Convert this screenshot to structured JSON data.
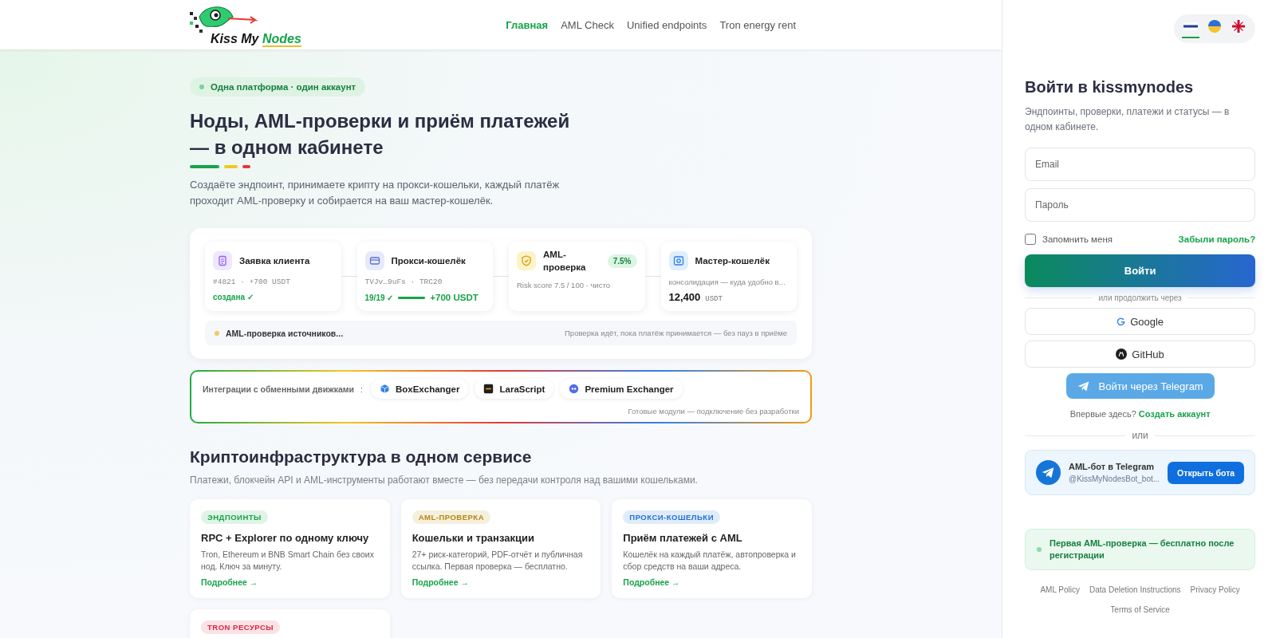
{
  "header": {
    "logo": {
      "text": "Kiss My",
      "accent": "Nodes"
    },
    "nav": [
      {
        "label": "Главная",
        "selected": true
      },
      {
        "label": "AML Check",
        "selected": false
      },
      {
        "label": "Unified endpoints",
        "selected": false
      },
      {
        "label": "Tron energy rent",
        "selected": false
      }
    ]
  },
  "hero": {
    "badge": "Одна платформа · один аккаунт",
    "title": "Ноды, AML-проверки и приём платежей — в одном кабинете",
    "lead": "Создаёте эндпоинт, принимаете крипту на прокси-кошельки, каждый платёж проходит AML-проверку и собирается на ваш мастер-кошелёк."
  },
  "pipeline": {
    "steps": [
      {
        "kind": "request",
        "title": "Заявка клиента",
        "meta": "#4821 · +700 USDT",
        "status": "создана ✓"
      },
      {
        "kind": "proxy",
        "title": "Прокси-кошелёк",
        "meta": "TVJv…9uFs · TRC20",
        "count": "19/19 ✓",
        "level": 1,
        "amount": "+700 USDT"
      },
      {
        "kind": "aml",
        "title": "AML-проверка",
        "badge": "7.5%",
        "note": "Risk score 7.5 / 100 · чисто"
      },
      {
        "kind": "master",
        "title": "Мастер-кошелёк",
        "meta": "консолидация — куда удобно в...",
        "amount": "12,400",
        "unit": "USDT"
      }
    ],
    "status": {
      "label": "AML-проверка источников...",
      "note": "Проверка идёт, пока платёж принимается — без пауз в приёме"
    }
  },
  "integrations": {
    "label": "Интеграции с обменными движками",
    "separator": ":",
    "engines": [
      {
        "kind": "cube",
        "name": "BoxExchanger"
      },
      {
        "kind": "square",
        "name": "LaraScript"
      },
      {
        "kind": "dots",
        "name": "Premium Exchanger"
      }
    ],
    "note": "Готовые модули — подключение без разработки"
  },
  "services": {
    "title": "Криптоинфраструктура в одном сервисе",
    "subtitle": "Платежи, блокчейн API и AML-инструменты работают вместе — без передачи контроля над вашими кошельками.",
    "cards": [
      {
        "tag": "ЭНДПОИНТЫ",
        "color": "#16a34a",
        "title": "RPC + Explorer по одному ключу",
        "text": "Tron, Ethereum и BNB Smart Chain без своих нод. Ключ за минуту.",
        "link": "Подробнее →"
      },
      {
        "tag": "AML-ПРОВЕРКА",
        "color": "#b7860b",
        "title": "Кошельки и транзакции",
        "text": "27+ риск-категорий, PDF-отчёт и публичная ссылка. Первая проверка — бесплатно.",
        "link": "Подробнее →"
      },
      {
        "tag": "ПРОКСИ-КОШЕЛЬКИ",
        "color": "#1d6fd8",
        "title": "Приём платежей с AML",
        "text": "Кошелёк на каждый платёж, автопроверка и сбор средств на ваши адреса.",
        "link": "Подробнее →"
      },
      {
        "tag": "TRON РЕСУРСЫ",
        "color": "#dc2640"
      }
    ]
  },
  "login": {
    "languages": [
      {
        "kind": "stripes",
        "selected": true
      },
      {
        "kind": "halves",
        "selected": false
      },
      {
        "kind": "cross",
        "selected": false
      }
    ],
    "title": "Войти в kissmynodes",
    "subtitle": "Эндпоинты, проверки, платежи и статусы — в одном кабинете.",
    "email": {
      "placeholder": "Email"
    },
    "password": {
      "placeholder": "Пароль"
    },
    "remember": {
      "label": "Запомнить меня",
      "checked": false
    },
    "forgot": "Забыли пароль?",
    "submit": "Войти",
    "divider": "или продолжить через",
    "providers": [
      {
        "kind": "google",
        "label": "Google"
      },
      {
        "kind": "github",
        "label": "GitHub"
      }
    ],
    "telegram": "Войти через Telegram",
    "signup": {
      "text": "Впервые здесь?",
      "link": "Создать аккаунт"
    },
    "or": "или",
    "bot": {
      "title": "AML-бот в Telegram",
      "handle": "@KissMyNodesBot_bot...",
      "button": "Открыть бота"
    },
    "notice": "Первая AML-проверка — бесплатно после регистрации",
    "links": [
      "AML Policy",
      "Data Deletion Instructions",
      "Privacy Policy",
      "Terms of Service"
    ]
  }
}
